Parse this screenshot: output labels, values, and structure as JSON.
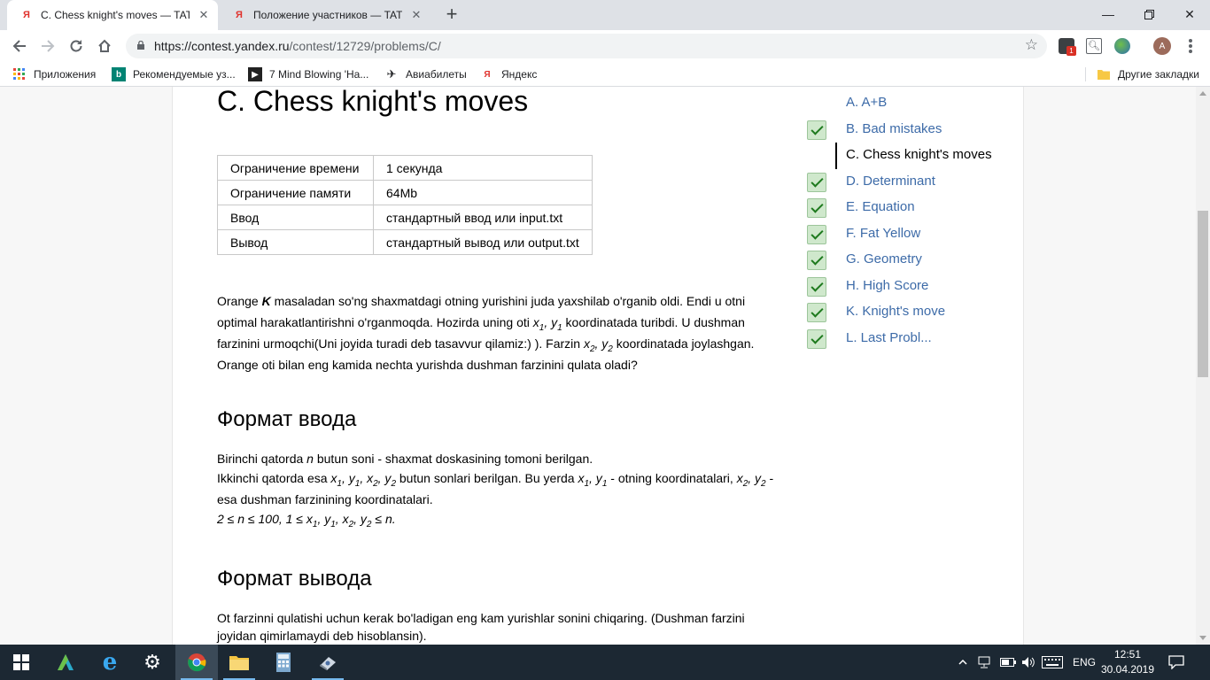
{
  "browser": {
    "tabs": [
      {
        "title": "C. Chess knight's moves — TATU",
        "favicon": "Я"
      },
      {
        "title": "Положение участников — TATU",
        "favicon": "Я"
      }
    ],
    "url_host": "https://contest.yandex.ru",
    "url_path": "/contest/12729/problems/C/",
    "avatar_letter": "A",
    "extension_badge": "1",
    "bookmarks": [
      {
        "label": "Приложения",
        "icon": "apps-grid-icon"
      },
      {
        "label": "Рекомендуемые уз...",
        "icon": "bing-icon"
      },
      {
        "label": "7 Mind Blowing 'Ha...",
        "icon": "video-icon"
      },
      {
        "label": "Авиабилеты",
        "icon": "plane-icon"
      },
      {
        "label": "Яндекс",
        "icon": "yandex-icon"
      }
    ],
    "other_bookmarks": "Другие закладки"
  },
  "problem": {
    "title": "C. Chess knight's moves",
    "limits": [
      {
        "key": "Ограничение времени",
        "value": "1 секунда"
      },
      {
        "key": "Ограничение памяти",
        "value": "64Mb"
      },
      {
        "key": "Ввод",
        "value": "стандартный ввод или input.txt"
      },
      {
        "key": "Вывод",
        "value": "стандартный вывод или output.txt"
      }
    ],
    "statement": {
      "p1": "Orange ",
      "k": "K",
      "p2": " masaladan so'ng shaxmatdagi otning yurishini juda yaxshilab o'rganib oldi. Endi u otni optimal harakatlantirishni o'rganmoqda. Hozirda uning oti ",
      "x1": "x",
      "s1": "1",
      "c1": ", ",
      "y1": "y",
      "s2": "1",
      "p3": " koordinatada turibdi. U dushman farzinini urmoqchi(Uni joyida turadi deb tasavvur qilamiz:) ). Farzin ",
      "x2": "x",
      "s3": "2",
      "c2": ", ",
      "y2": "y",
      "s4": "2",
      "p4": " koordinatada joylashgan. Orange oti bilan eng kamida nechta yurishda dushman farzinini qulata oladi?"
    },
    "input_heading": "Формат ввода",
    "input": {
      "l1a": "Birinchi qatorda ",
      "n": "n",
      "l1b": " butun soni - shaxmat doskasining tomoni berilgan.",
      "l2a": "Ikkinchi qatorda esa ",
      "vars1": "x",
      "v1s": "1",
      "vars2": ", y",
      "v2s": "1",
      "vars3": ", x",
      "v3s": "2",
      "vars4": ", y",
      "v4s": "2",
      "l2b": " butun sonlari berilgan. Bu yerda ",
      "w1": "x",
      "w1s": "1",
      "w2": ", y",
      "w2s": "1",
      "l2c": " - otning koordinatalari, ",
      "z1": "x",
      "z1s": "2",
      "z2": ", y",
      "z2s": "2",
      "l2d": " - esa dushman farzinining koordinatalari.",
      "c_a": "2 ≤ n ≤ 100, 1 ≤ x",
      "c_s1": "1",
      "c_b": ", y",
      "c_s2": "1",
      "c_c": ", x",
      "c_s3": "2",
      "c_d": ", y",
      "c_s4": "2",
      "c_e": " ≤ n."
    },
    "output_heading": "Формат вывода",
    "output_text": "Ot farzinni qulatishi uchun kerak bo'ladigan eng kam yurishlar sonini chiqaring. (Dushman farzini joyidan qimirlamaydi deb hisoblansin)."
  },
  "problems_nav": [
    {
      "label": "A. A+B",
      "solved": false,
      "current": false
    },
    {
      "label": "B. Bad mistakes",
      "solved": true,
      "current": false
    },
    {
      "label": "C. Chess knight's moves",
      "solved": false,
      "current": true
    },
    {
      "label": "D. Determinant",
      "solved": true,
      "current": false
    },
    {
      "label": "E. Equation",
      "solved": true,
      "current": false
    },
    {
      "label": "F. Fat Yellow",
      "solved": true,
      "current": false
    },
    {
      "label": "G. Geometry",
      "solved": true,
      "current": false
    },
    {
      "label": "H. High Score",
      "solved": true,
      "current": false
    },
    {
      "label": "K. Knight's move",
      "solved": true,
      "current": false
    },
    {
      "label": "L. Last Probl...",
      "solved": true,
      "current": false
    }
  ],
  "taskbar": {
    "language": "ENG",
    "time": "12:51",
    "date": "30.04.2019"
  },
  "colors": {
    "link": "#3d6ba8",
    "check_bg": "#cfe8cc",
    "check_mark": "#1e7a1e",
    "taskbar": "#1c2833"
  }
}
